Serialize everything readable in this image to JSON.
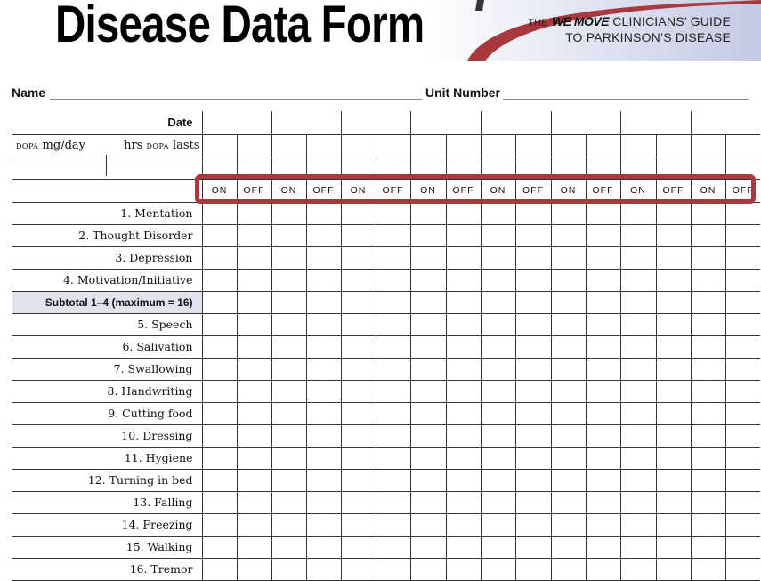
{
  "header": {
    "title": "Disease Data Form",
    "banner_line1_prefix": "THE",
    "banner_brand": "WE MOVE",
    "banner_line1_suffix": "CLINICIANS’ GUIDE",
    "banner_line2": "TO PARKINSON’S DISEASE",
    "accent_color": "#a83a3f"
  },
  "fields": {
    "name_label": "Name",
    "unit_label": "Unit Number",
    "date_label": "Date",
    "dopa_label": "DOPA mg/day",
    "dopa_hrs_label": "hrs DOPA lasts"
  },
  "states": [
    "ON",
    "OFF",
    "ON",
    "OFF",
    "ON",
    "OFF",
    "ON",
    "OFF",
    "ON",
    "OFF",
    "ON",
    "OFF",
    "ON",
    "OFF",
    "ON",
    "OFF"
  ],
  "rows": [
    {
      "label": "1. Mentation"
    },
    {
      "label": "2. Thought Disorder"
    },
    {
      "label": "3. Depression"
    },
    {
      "label": "4. Motivation/Initiative"
    },
    {
      "label": "Subtotal 1–4 (maximum = 16)",
      "subtotal": true
    },
    {
      "label": "5. Speech"
    },
    {
      "label": "6. Salivation"
    },
    {
      "label": "7. Swallowing"
    },
    {
      "label": "8. Handwriting"
    },
    {
      "label": "9. Cutting food"
    },
    {
      "label": "10. Dressing"
    },
    {
      "label": "11. Hygiene"
    },
    {
      "label": "12. Turning in bed"
    },
    {
      "label": "13. Falling"
    },
    {
      "label": "14. Freezing"
    },
    {
      "label": "15. Walking"
    },
    {
      "label": "16. Tremor"
    }
  ]
}
